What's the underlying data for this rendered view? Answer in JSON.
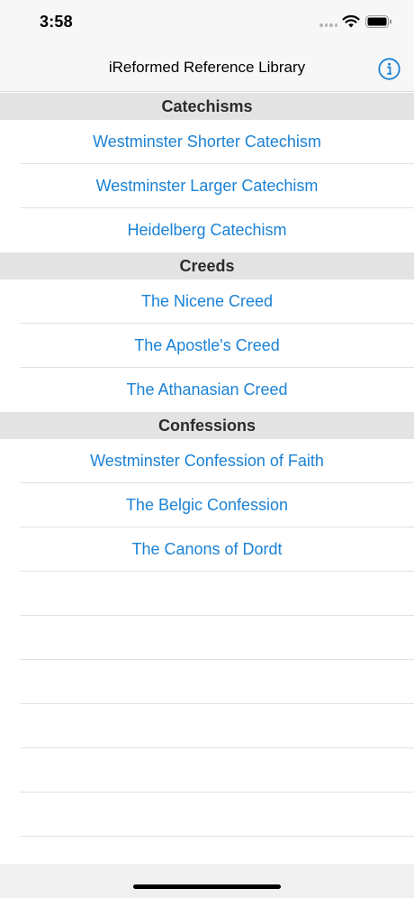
{
  "status_bar": {
    "time": "3:58",
    "icons": [
      "cellular-dots-icon",
      "wifi-icon",
      "battery-icon"
    ]
  },
  "nav_bar": {
    "title": "iReformed Reference Library",
    "info_icon": "info-circle-icon"
  },
  "colors": {
    "link": "#1a82d6",
    "section_bg": "#e3e3e3",
    "nav_bg": "#f7f7f7"
  },
  "sections": [
    {
      "title": "Catechisms",
      "items": [
        "Westminster Shorter Catechism",
        "Westminster Larger Catechism",
        "Heidelberg Catechism"
      ]
    },
    {
      "title": "Creeds",
      "items": [
        "The Nicene Creed",
        "The Apostle's Creed",
        "The Athanasian Creed"
      ]
    },
    {
      "title": "Confessions",
      "items": [
        "Westminster Confession of Faith",
        "The Belgic Confession",
        "The Canons of Dordt"
      ]
    }
  ]
}
